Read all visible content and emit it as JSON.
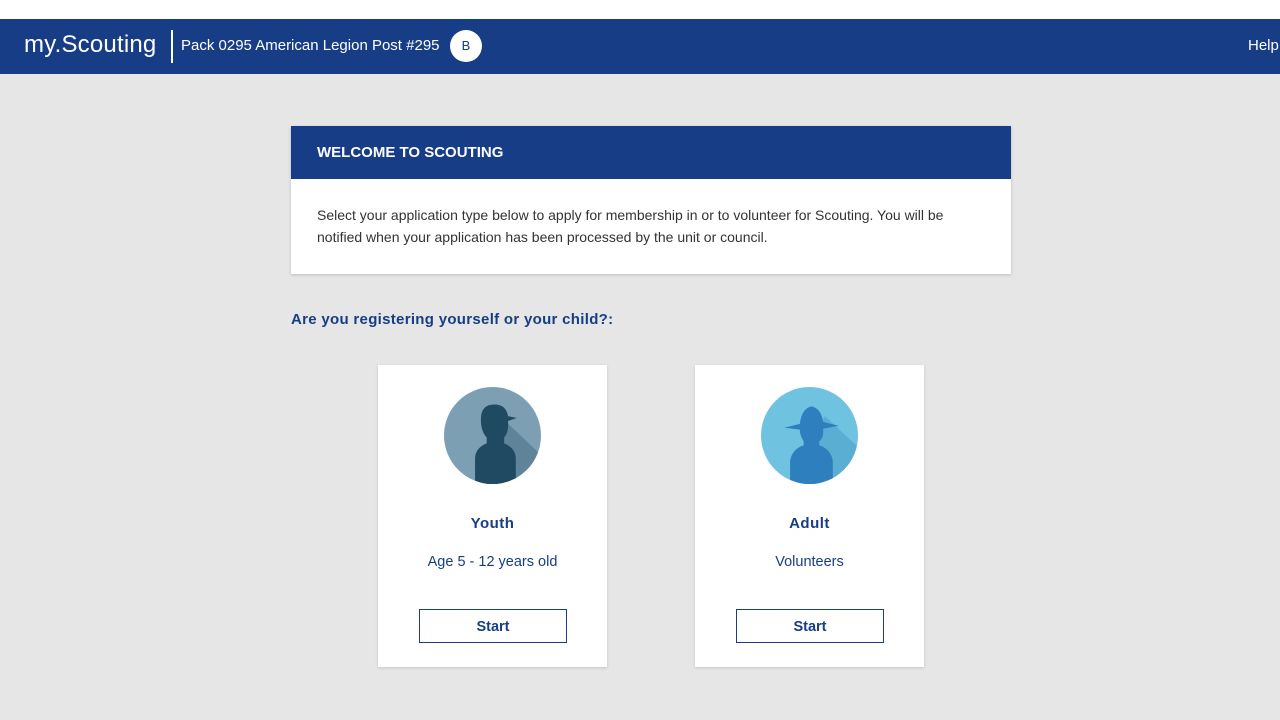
{
  "header": {
    "logo": "my.Scouting",
    "unit_name": "Pack 0295 American Legion Post #295",
    "avatar_initial": "B",
    "help_label": "Help"
  },
  "welcome": {
    "title": "WELCOME TO SCOUTING",
    "body": "Select your application type below to apply for membership in or to volunteer for Scouting. You will be notified when your application has been processed by the unit or council."
  },
  "question": "Are you registering yourself or your child?:",
  "options": [
    {
      "icon": "youth-scout-icon",
      "title": "Youth",
      "subtitle": "Age 5 - 12 years old",
      "button_label": "Start"
    },
    {
      "icon": "adult-scout-icon",
      "title": "Adult",
      "subtitle": "Volunteers",
      "button_label": "Start"
    }
  ],
  "colors": {
    "nav_blue": "#173d87",
    "page_background": "#e6e6e6",
    "youth_circle": "#7d9fb3",
    "youth_silhouette": "#1f4a62",
    "adult_circle": "#6fc3e0",
    "adult_silhouette": "#2e7fbd"
  }
}
